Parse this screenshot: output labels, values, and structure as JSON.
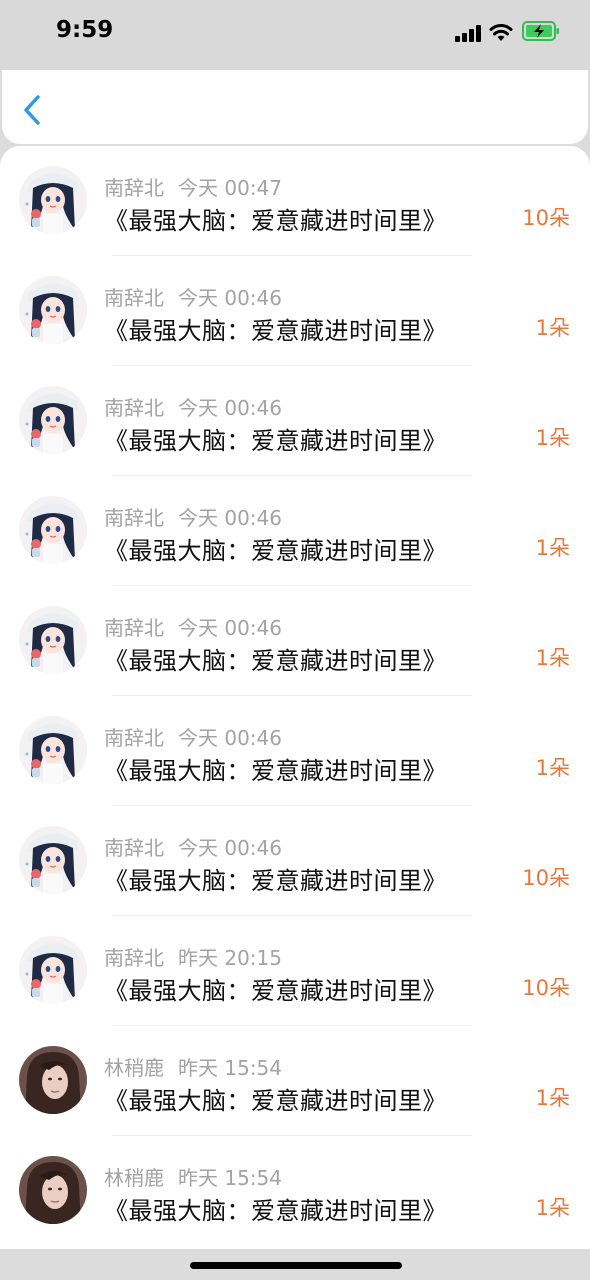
{
  "status_bar": {
    "time": "9:59"
  },
  "list": {
    "items": [
      {
        "name": "南辞北",
        "time": "今天 00:47",
        "title": "《最强大脑：爱意藏进时间里》",
        "count": "10朵",
        "avatar": "anime-girl"
      },
      {
        "name": "南辞北",
        "time": "今天 00:46",
        "title": "《最强大脑：爱意藏进时间里》",
        "count": "1朵",
        "avatar": "anime-girl"
      },
      {
        "name": "南辞北",
        "time": "今天 00:46",
        "title": "《最强大脑：爱意藏进时间里》",
        "count": "1朵",
        "avatar": "anime-girl"
      },
      {
        "name": "南辞北",
        "time": "今天 00:46",
        "title": "《最强大脑：爱意藏进时间里》",
        "count": "1朵",
        "avatar": "anime-girl"
      },
      {
        "name": "南辞北",
        "time": "今天 00:46",
        "title": "《最强大脑：爱意藏进时间里》",
        "count": "1朵",
        "avatar": "anime-girl"
      },
      {
        "name": "南辞北",
        "time": "今天 00:46",
        "title": "《最强大脑：爱意藏进时间里》",
        "count": "1朵",
        "avatar": "anime-girl"
      },
      {
        "name": "南辞北",
        "time": "今天 00:46",
        "title": "《最强大脑：爱意藏进时间里》",
        "count": "10朵",
        "avatar": "anime-girl"
      },
      {
        "name": "南辞北",
        "time": "昨天 20:15",
        "title": "《最强大脑：爱意藏进时间里》",
        "count": "10朵",
        "avatar": "anime-girl"
      },
      {
        "name": "林稍鹿",
        "time": "昨天 15:54",
        "title": "《最强大脑：爱意藏进时间里》",
        "count": "1朵",
        "avatar": "photo-woman"
      },
      {
        "name": "林稍鹿",
        "time": "昨天 15:54",
        "title": "《最强大脑：爱意藏进时间里》",
        "count": "1朵",
        "avatar": "photo-woman"
      }
    ]
  },
  "colors": {
    "accent_count": "#e8773a",
    "back_icon": "#2d9be0",
    "meta_text": "#a3a3a3"
  }
}
